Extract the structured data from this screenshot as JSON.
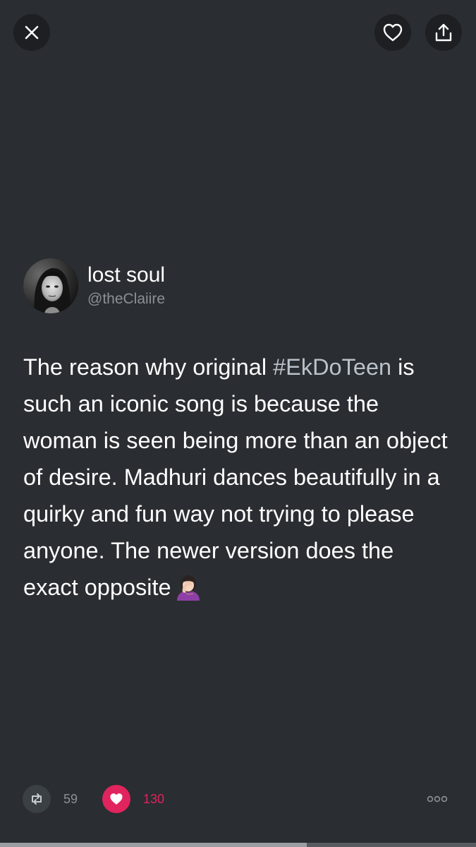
{
  "top_bar": {
    "close_icon": "close-icon",
    "like_icon": "heart-outline-icon",
    "share_icon": "share-icon"
  },
  "tweet": {
    "author": {
      "display_name": "lost soul",
      "handle": "@theClaiire",
      "avatar": "avatar-photo"
    },
    "text": {
      "before_hashtag": "The reason why original ",
      "hashtag": "#EkDoTeen",
      "after_hashtag": " is such an iconic song is because the woman is seen being more than an object of desire. Madhuri dances beautifully in a quirky and fun way not trying to please anyone. The newer version does the exact opposite",
      "emoji": "woman-facepalming-emoji"
    },
    "actions": {
      "retweet_count": "59",
      "like_count": "130",
      "retweet_icon": "retweet-icon",
      "like_icon": "heart-filled-icon",
      "more_icon": "more-icon"
    }
  },
  "colors": {
    "background": "#2a2d31",
    "button_background": "#1d1f22",
    "text_primary": "#ffffff",
    "text_secondary": "#8b9197",
    "hashtag": "#b9c1c9",
    "like_accent": "#e0245e"
  }
}
